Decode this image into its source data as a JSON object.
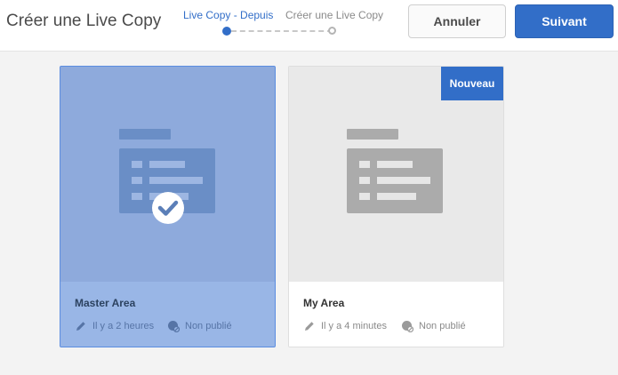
{
  "header": {
    "title": "Créer une Live Copy",
    "steps": [
      {
        "label": "Live Copy - Depuis",
        "active": true
      },
      {
        "label": "Créer une Live Copy",
        "active": false
      }
    ],
    "cancel_label": "Annuler",
    "next_label": "Suivant"
  },
  "cards": [
    {
      "name": "Master Area",
      "edited": "Il y a 2 heures",
      "status": "Non publié",
      "selected": true,
      "icon": "folder-icon"
    },
    {
      "name": "My Area",
      "edited": "Il y a 4 minutes",
      "status": "Non publié",
      "badge": "Nouveau",
      "selected": false,
      "icon": "folder-icon"
    }
  ],
  "colors": {
    "accent": "#326ec8",
    "selected_card": "#8aaadf"
  }
}
